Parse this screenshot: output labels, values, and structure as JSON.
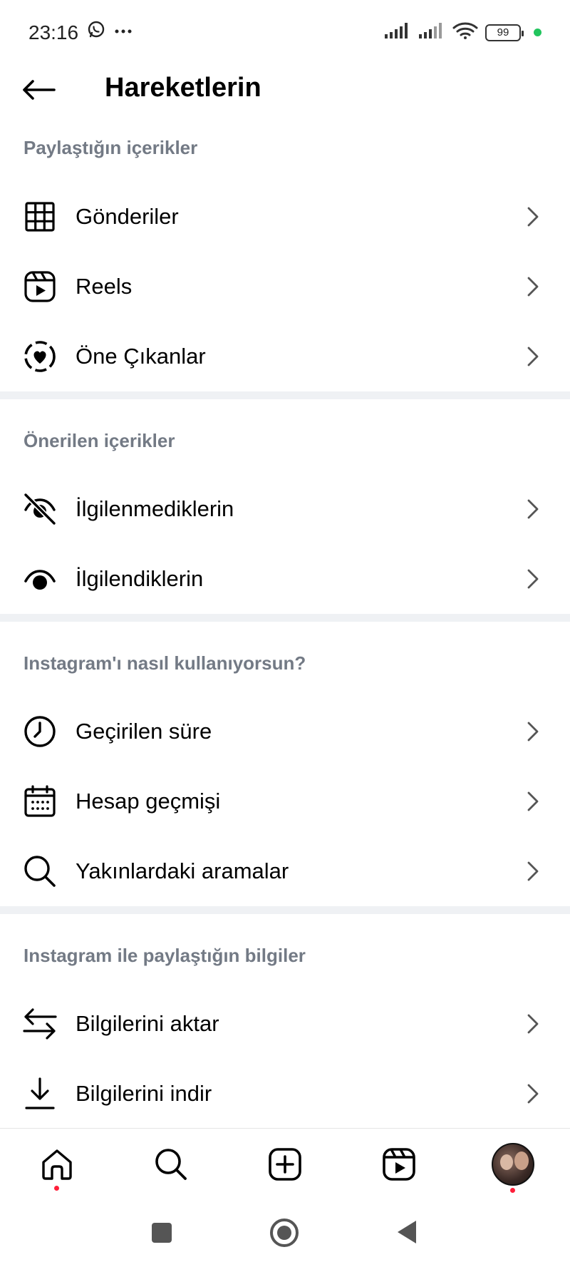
{
  "status_bar": {
    "time": "23:16",
    "battery": "99"
  },
  "header": {
    "title": "Hareketlerin"
  },
  "sections": [
    {
      "heading": "Paylaştığın içerikler",
      "items": [
        {
          "label": "Gönderiler",
          "icon": "grid-icon"
        },
        {
          "label": "Reels",
          "icon": "reels-icon"
        },
        {
          "label": "Öne Çıkanlar",
          "icon": "highlights-icon"
        }
      ]
    },
    {
      "heading": "Önerilen içerikler",
      "items": [
        {
          "label": "İlgilenmediklerin",
          "icon": "eye-off-icon"
        },
        {
          "label": "İlgilendiklerin",
          "icon": "eye-icon"
        }
      ]
    },
    {
      "heading": "Instagram'ı nasıl kullanıyorsun?",
      "items": [
        {
          "label": "Geçirilen süre",
          "icon": "clock-icon"
        },
        {
          "label": "Hesap geçmişi",
          "icon": "calendar-icon"
        },
        {
          "label": "Yakınlardaki aramalar",
          "icon": "search-icon"
        }
      ]
    },
    {
      "heading": "Instagram ile paylaştığın bilgiler",
      "items": [
        {
          "label": "Bilgilerini aktar",
          "icon": "transfer-icon"
        },
        {
          "label": "Bilgilerini indir",
          "icon": "download-icon"
        }
      ]
    }
  ],
  "colors": {
    "section_heading": "#737a85",
    "divider": "#eff1f4",
    "notification_dot": "#ff1f3a",
    "status_green": "#22c55e"
  }
}
